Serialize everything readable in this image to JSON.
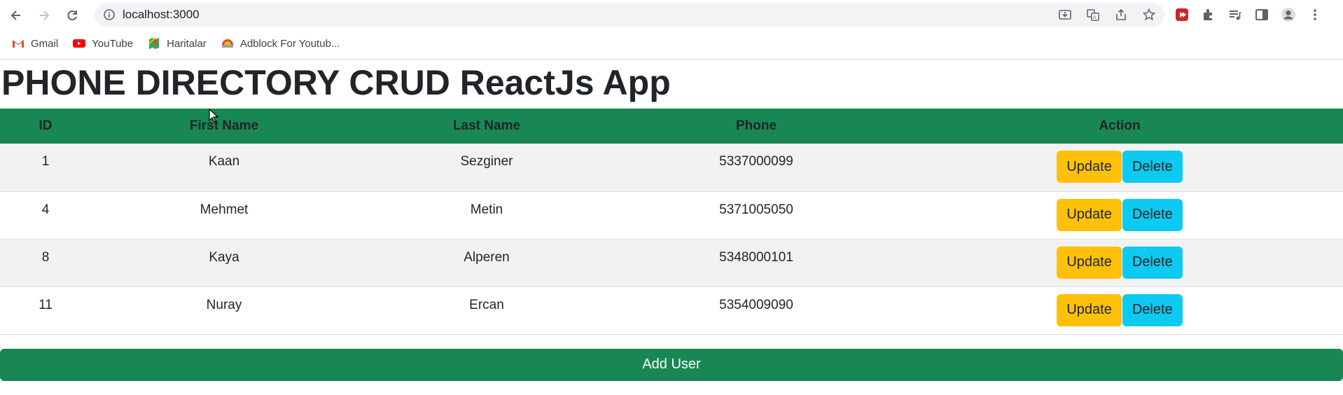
{
  "browser": {
    "url": "localhost:3000",
    "bookmarks": [
      {
        "label": "Gmail",
        "icon": "gmail-icon"
      },
      {
        "label": "YouTube",
        "icon": "youtube-icon"
      },
      {
        "label": "Haritalar",
        "icon": "maps-icon"
      },
      {
        "label": "Adblock For Youtub...",
        "icon": "adblock-icon"
      }
    ]
  },
  "page": {
    "title": "PHONE DIRECTORY CRUD ReactJs App",
    "columns": {
      "id": "ID",
      "first": "First Name",
      "last": "Last Name",
      "phone": "Phone",
      "action": "Action"
    },
    "rows": [
      {
        "id": "1",
        "first": "Kaan",
        "last": "Sezginer",
        "phone": "5337000099"
      },
      {
        "id": "4",
        "first": "Mehmet",
        "last": "Metin",
        "phone": "5371005050"
      },
      {
        "id": "8",
        "first": "Kaya",
        "last": "Alperen",
        "phone": "5348000101"
      },
      {
        "id": "11",
        "first": "Nuray",
        "last": "Ercan",
        "phone": "5354009090"
      }
    ],
    "update_label": "Update",
    "delete_label": "Delete",
    "add_label": "Add User"
  },
  "colors": {
    "header_green": "#198754",
    "update_yellow": "#ffc107",
    "delete_cyan": "#0dcaf0"
  }
}
